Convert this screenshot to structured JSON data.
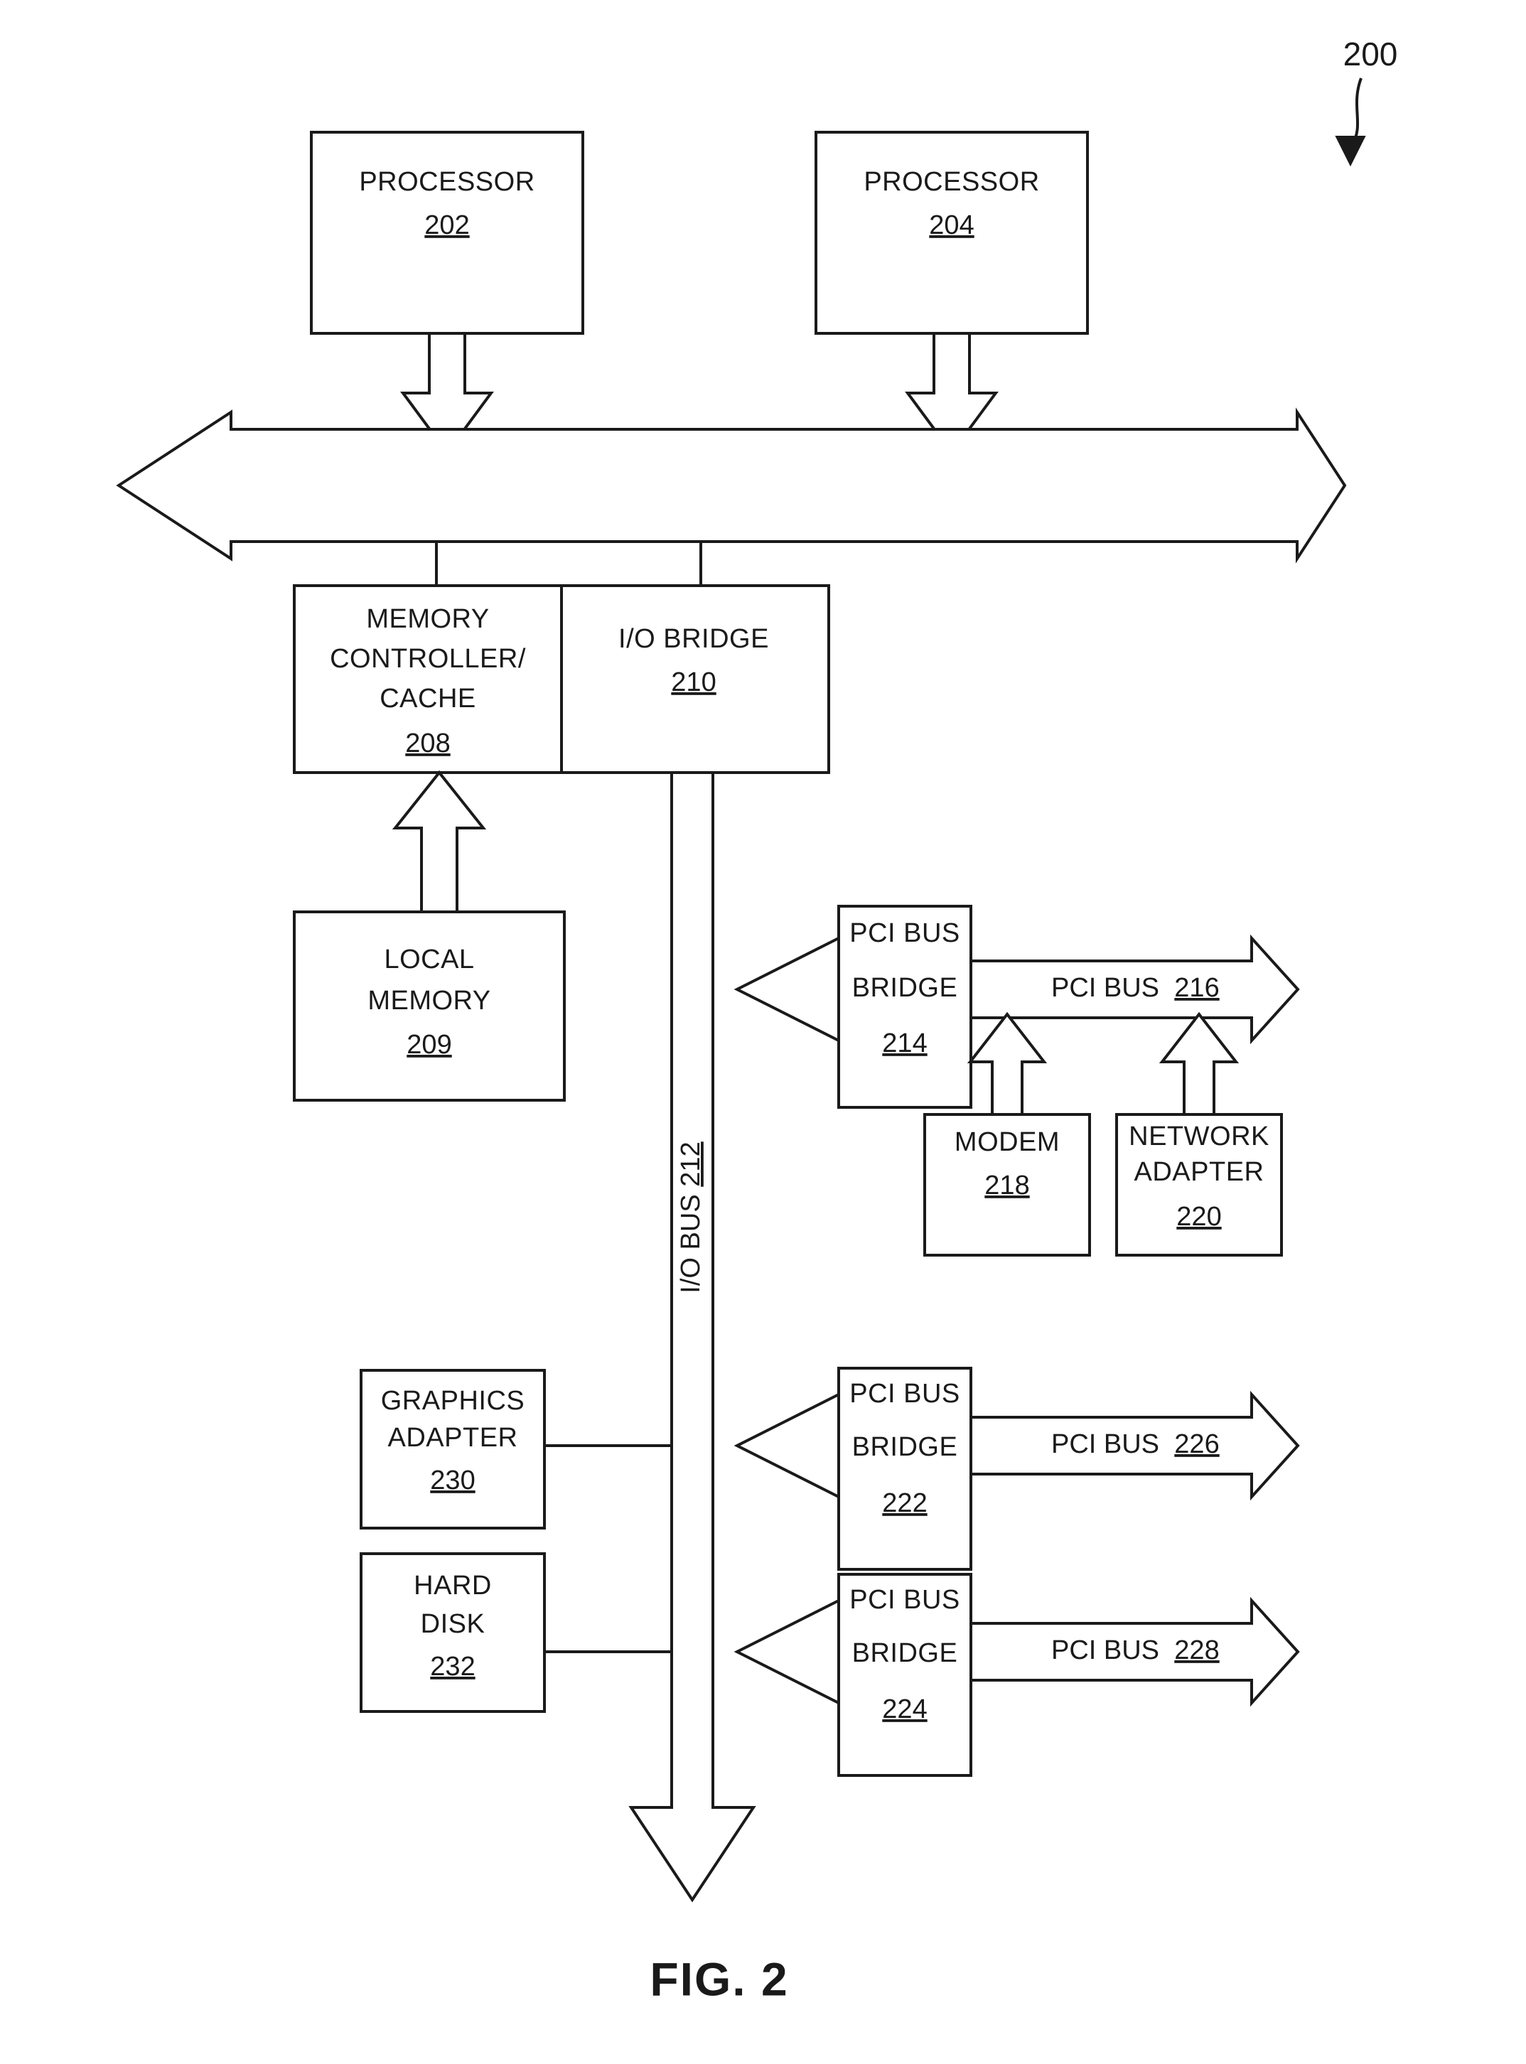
{
  "figure": {
    "caption": "FIG. 2",
    "callout_reference": "200"
  },
  "blocks": {
    "processor_left": {
      "label": "PROCESSOR",
      "ref": "202"
    },
    "processor_right": {
      "label": "PROCESSOR",
      "ref": "204"
    },
    "memory_controller": {
      "label_line1": "MEMORY",
      "label_line2": "CONTROLLER/",
      "label_line3": "CACHE",
      "ref": "208"
    },
    "io_bridge": {
      "label": "I/O BRIDGE",
      "ref": "210"
    },
    "local_memory": {
      "label_line1": "LOCAL",
      "label_line2": "MEMORY",
      "ref": "209"
    },
    "pci_bridge_214": {
      "label_line1": "PCI BUS",
      "label_line2": "BRIDGE",
      "ref": "214"
    },
    "pci_bridge_222": {
      "label_line1": "PCI BUS",
      "label_line2": "BRIDGE",
      "ref": "222"
    },
    "pci_bridge_224": {
      "label_line1": "PCI BUS",
      "label_line2": "BRIDGE",
      "ref": "224"
    },
    "modem": {
      "label": "MODEM",
      "ref": "218"
    },
    "network_adapter": {
      "label_line1": "NETWORK",
      "label_line2": "ADAPTER",
      "ref": "220"
    },
    "graphics_adapter": {
      "label_line1": "GRAPHICS",
      "label_line2": "ADAPTER",
      "ref": "230"
    },
    "hard_disk": {
      "label_line1": "HARD",
      "label_line2": "DISK",
      "ref": "232"
    }
  },
  "buses": {
    "io_bus": {
      "name": "I/O BUS",
      "ref": "212"
    },
    "pci_bus_216": {
      "name": "PCI BUS",
      "ref": "216"
    },
    "pci_bus_226": {
      "name": "PCI BUS",
      "ref": "226"
    },
    "pci_bus_228": {
      "name": "PCI BUS",
      "ref": "228"
    }
  },
  "colors": {
    "ink": "#1a1a1a",
    "paper": "#ffffff"
  }
}
